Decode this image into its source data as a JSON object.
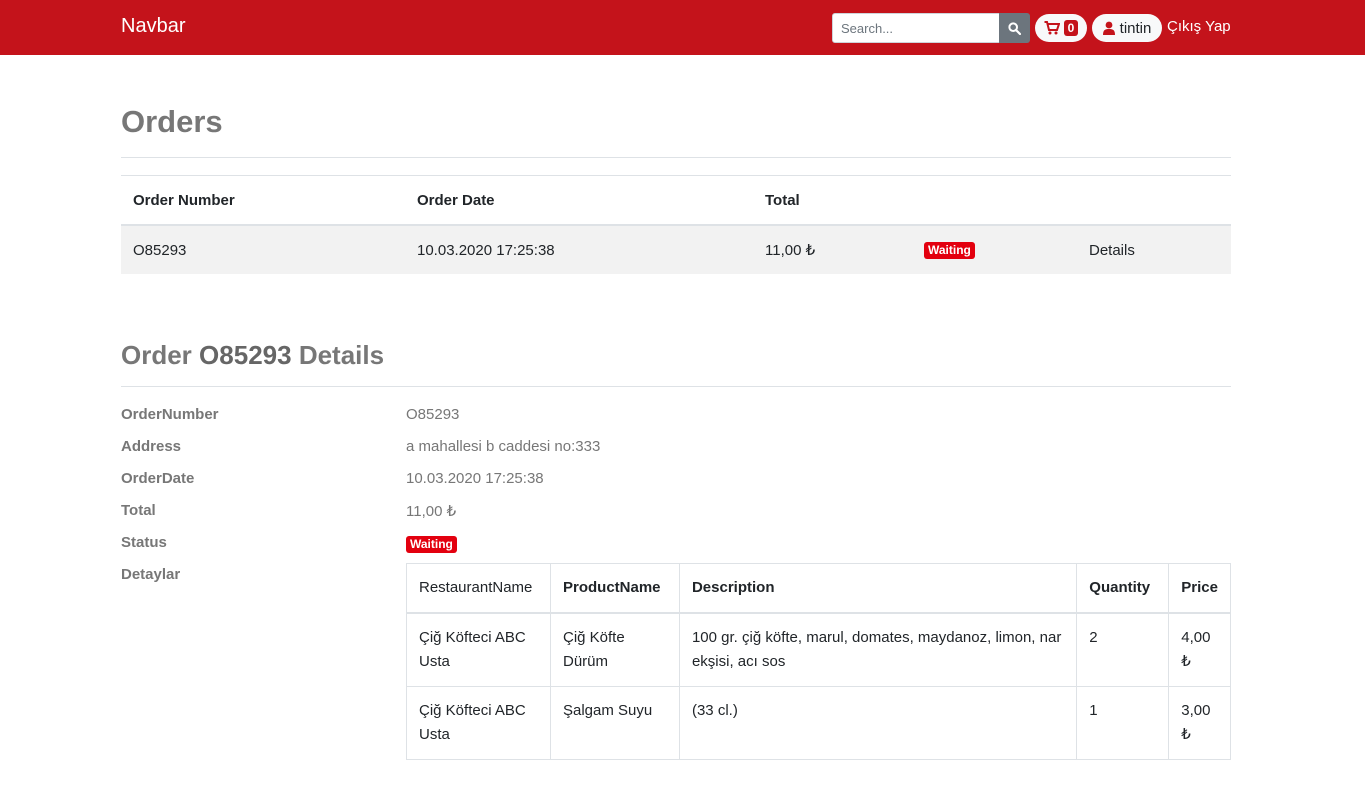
{
  "navbar": {
    "brand": "Navbar",
    "search_placeholder": "Search...",
    "cart_count": "0",
    "username": "tintin",
    "logout_label": "Çıkış Yap"
  },
  "orders": {
    "title": "Orders",
    "headers": [
      "Order Number",
      "Order Date",
      "Total"
    ],
    "rows": [
      {
        "order_number": "O85293",
        "order_date": "10.03.2020 17:25:38",
        "total": "11,00 ₺",
        "status": "Waiting",
        "details_label": "Details"
      }
    ]
  },
  "order_details": {
    "title_prefix": "Order",
    "title_number": "O85293",
    "title_suffix": "Details",
    "fields": [
      {
        "label": "OrderNumber",
        "value": "O85293"
      },
      {
        "label": "Address",
        "value": "a mahallesi b caddesi no:333"
      },
      {
        "label": "OrderDate",
        "value": "10.03.2020 17:25:38"
      },
      {
        "label": "Total",
        "value": "11,00 ₺"
      },
      {
        "label": "Status",
        "value": "Waiting"
      },
      {
        "label": "Detaylar",
        "value": ""
      }
    ],
    "items": {
      "headers": [
        "RestaurantName",
        "ProductName",
        "Description",
        "Quantity",
        "Price"
      ],
      "rows": [
        {
          "restaurant": "Çiğ Köfteci ABC Usta",
          "product": "Çiğ Köfte Dürüm",
          "description": "100 gr. çiğ köfte, marul, domates, maydanoz, limon, nar ekşisi, acı sos",
          "quantity": "2",
          "price": "4,00 ₺"
        },
        {
          "restaurant": "Çiğ Köfteci ABC Usta",
          "product": "Şalgam Suyu",
          "description": "(33 cl.)",
          "quantity": "1",
          "price": "3,00 ₺"
        }
      ]
    }
  },
  "colors": {
    "navbar": "#c4131b",
    "badge": "#e3000f"
  }
}
